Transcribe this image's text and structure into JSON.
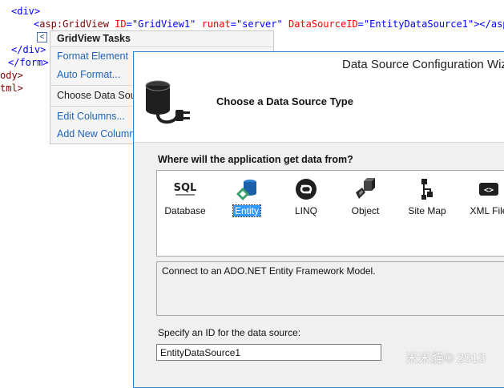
{
  "editor": {
    "line1": "<div>",
    "line2_tag": "asp:GridView",
    "line2_attr1": "ID",
    "line2_val1": "\"GridView1\"",
    "line2_attr2": "runat",
    "line2_val2": "\"server\"",
    "line2_attr3": "DataSourceID",
    "line2_val3": "\"EntityDataSource1\"",
    "line2_end": "></asp:",
    "line3": "</div>",
    "line4": "</form>",
    "line5": "ody>",
    "line6": "tml>"
  },
  "smart_tag": {
    "glyph": "<"
  },
  "gridview_tasks": {
    "title": "GridView Tasks",
    "items": [
      {
        "label": "Format Element"
      },
      {
        "label": "Auto Format..."
      },
      {
        "label": "Choose Data Source"
      },
      {
        "label": "Edit Columns..."
      },
      {
        "label": "Add New Column..."
      }
    ]
  },
  "dialog": {
    "title": "Data Source Configuration Wizard",
    "step_title": "Choose a Data Source Type",
    "question": "Where will the application get data from?",
    "source_types": [
      {
        "label": "Database",
        "icon": "sql-database-icon",
        "icon_text": "SQL",
        "selected": false
      },
      {
        "label": "Entity",
        "icon": "entity-icon",
        "selected": true
      },
      {
        "label": "LINQ",
        "icon": "linq-icon",
        "selected": false
      },
      {
        "label": "Object",
        "icon": "object-icon",
        "selected": false
      },
      {
        "label": "Site Map",
        "icon": "site-map-icon",
        "selected": false
      },
      {
        "label": "XML File",
        "icon": "xml-file-icon",
        "icon_text": "<>",
        "selected": false
      }
    ],
    "description": "Connect to an ADO.NET Entity Framework Model.",
    "id_label": "Specify an ID for the data source:",
    "id_value": "EntityDataSource1"
  },
  "watermark": "米米貓© 2013",
  "colors": {
    "accent": "#2a85d5",
    "link": "#1e63b5",
    "selection": "#3399ff"
  }
}
